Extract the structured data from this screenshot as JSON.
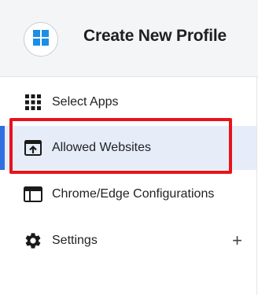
{
  "header": {
    "title": "Create New Profile",
    "logo_icon": "windows-logo-icon"
  },
  "nav": {
    "items": [
      {
        "label": "Select Apps",
        "icon": "grid-icon",
        "selected": false
      },
      {
        "label": "Allowed Websites",
        "icon": "open-in-browser-icon",
        "selected": true
      },
      {
        "label": "Chrome/Edge Configurations",
        "icon": "browser-window-icon",
        "selected": false
      },
      {
        "label": "Settings",
        "icon": "gear-icon",
        "selected": false,
        "expand_symbol": "+"
      }
    ]
  },
  "colors": {
    "accent": "#2f6fe0",
    "selected_bg": "#e6edf9",
    "highlight": "#e8131c",
    "header_bg": "#f4f5f6",
    "windows_blue": "#1b8fe6"
  }
}
